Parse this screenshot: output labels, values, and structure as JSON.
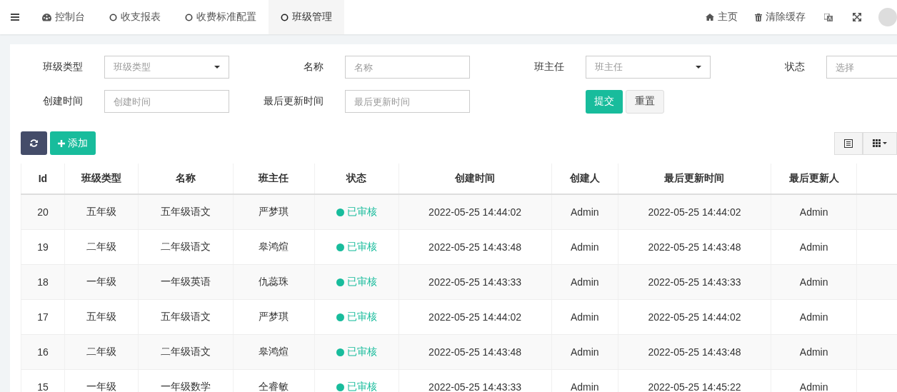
{
  "nav": {
    "tabs": [
      {
        "label": "控制台",
        "kind": "dashboard",
        "selected": false
      },
      {
        "label": "收支报表",
        "kind": "page",
        "selected": false
      },
      {
        "label": "收费标准配置",
        "kind": "page",
        "selected": false
      },
      {
        "label": "班级管理",
        "kind": "page",
        "selected": true
      }
    ],
    "links": [
      {
        "label": "主页",
        "kind": "home"
      },
      {
        "label": "清除缓存",
        "kind": "cache"
      }
    ]
  },
  "filters": [
    {
      "label": "班级类型",
      "kind": "select",
      "placeholder": "班级类型"
    },
    {
      "label": "名称",
      "kind": "input",
      "placeholder": "名称"
    },
    {
      "label": "班主任",
      "kind": "select",
      "placeholder": "班主任"
    },
    {
      "label": "状态",
      "kind": "input",
      "placeholder": "选择"
    },
    {
      "label": "创建时间",
      "kind": "input",
      "placeholder": "创建时间"
    },
    {
      "label": "最后更新时间",
      "kind": "input",
      "placeholder": "最后更新时间"
    }
  ],
  "form_buttons": [
    "提交",
    "重置"
  ],
  "toolbar": {
    "add": "添加"
  },
  "table": {
    "columns": [
      "Id",
      "班级类型",
      "名称",
      "班主任",
      "状态",
      "创建时间",
      "创建人",
      "最后更新时间",
      "最后更新人"
    ],
    "rows": [
      [
        "20",
        "五年级",
        "五年级语文",
        "严梦琪",
        "已审核",
        "2022-05-25 14:44:02",
        "Admin",
        "2022-05-25 14:44:02",
        "Admin"
      ],
      [
        "19",
        "二年级",
        "二年级语文",
        "皋鸿煊",
        "已审核",
        "2022-05-25 14:43:48",
        "Admin",
        "2022-05-25 14:43:48",
        "Admin"
      ],
      [
        "18",
        "一年级",
        "一年级英语",
        "仇蕊珠",
        "已审核",
        "2022-05-25 14:43:33",
        "Admin",
        "2022-05-25 14:43:33",
        "Admin"
      ],
      [
        "17",
        "五年级",
        "五年级语文",
        "严梦琪",
        "已审核",
        "2022-05-25 14:44:02",
        "Admin",
        "2022-05-25 14:44:02",
        "Admin"
      ],
      [
        "16",
        "二年级",
        "二年级语文",
        "皋鸿煊",
        "已审核",
        "2022-05-25 14:43:48",
        "Admin",
        "2022-05-25 14:43:48",
        "Admin"
      ],
      [
        "15",
        "一年级",
        "一年级数学",
        "仝睿敏",
        "已审核",
        "2022-05-25 14:43:33",
        "Admin",
        "2022-05-25 14:45:22",
        "Admin"
      ]
    ]
  }
}
